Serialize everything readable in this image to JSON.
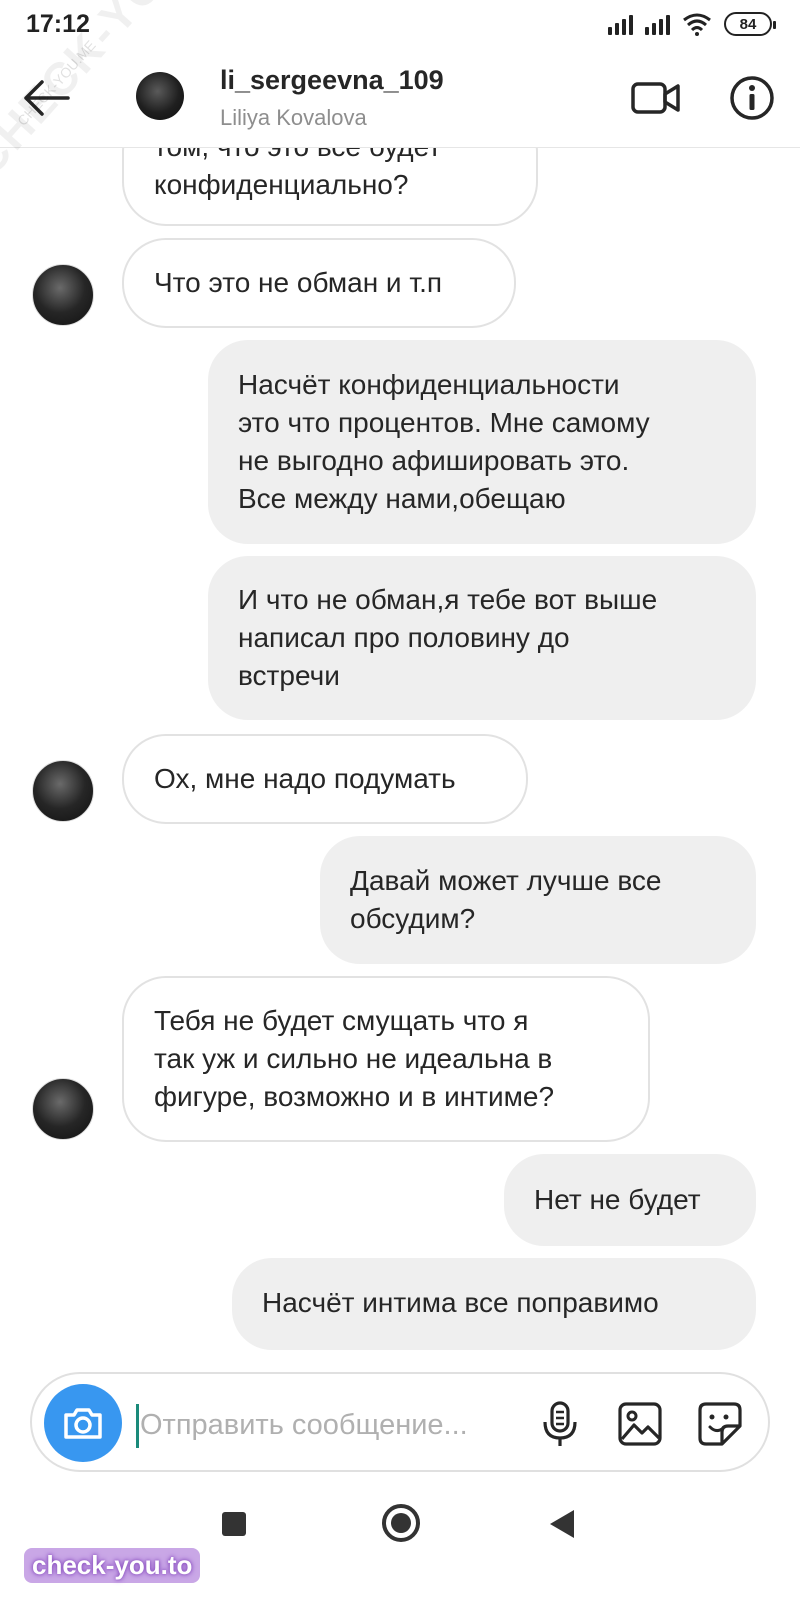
{
  "status_bar": {
    "time": "17:12",
    "battery": "84"
  },
  "header": {
    "username": "li_sergeevna_109",
    "full_name": "Liliya Kovalova"
  },
  "messages": [
    {
      "direction": "incoming",
      "text": "том, что это все будет\nконфиденциально?"
    },
    {
      "direction": "incoming",
      "text": "Что это не обман и т.п"
    },
    {
      "direction": "outgoing",
      "text": "Насчёт конфиденциальности\nэто что процентов. Мне самому\nне выгодно афишировать это.\nВсе между нами,обещаю"
    },
    {
      "direction": "outgoing",
      "text": "И что не обман,я тебе вот выше\nнаписал про половину до\nвстречи"
    },
    {
      "direction": "incoming",
      "text": "Ох, мне надо подумать"
    },
    {
      "direction": "outgoing",
      "text": "Давай может лучше все\nобсудим?"
    },
    {
      "direction": "incoming",
      "text": "Тебя не будет смущать что я\nтак уж и сильно не идеальна в\nфигуре, возможно и в интиме?"
    },
    {
      "direction": "outgoing",
      "text": "Нет не будет"
    },
    {
      "direction": "outgoing",
      "text": "Насчёт интима все поправимо"
    }
  ],
  "composer": {
    "placeholder": "Отправить сообщение..."
  },
  "watermarks": {
    "diagonal": "CHECK-YOU.ME",
    "small": "CHECK-YOU.ME",
    "corner": "check-you.to"
  },
  "colors": {
    "accent": "#3897f0",
    "incoming_border": "#e2e2e2",
    "outgoing_bg": "#efefef"
  }
}
